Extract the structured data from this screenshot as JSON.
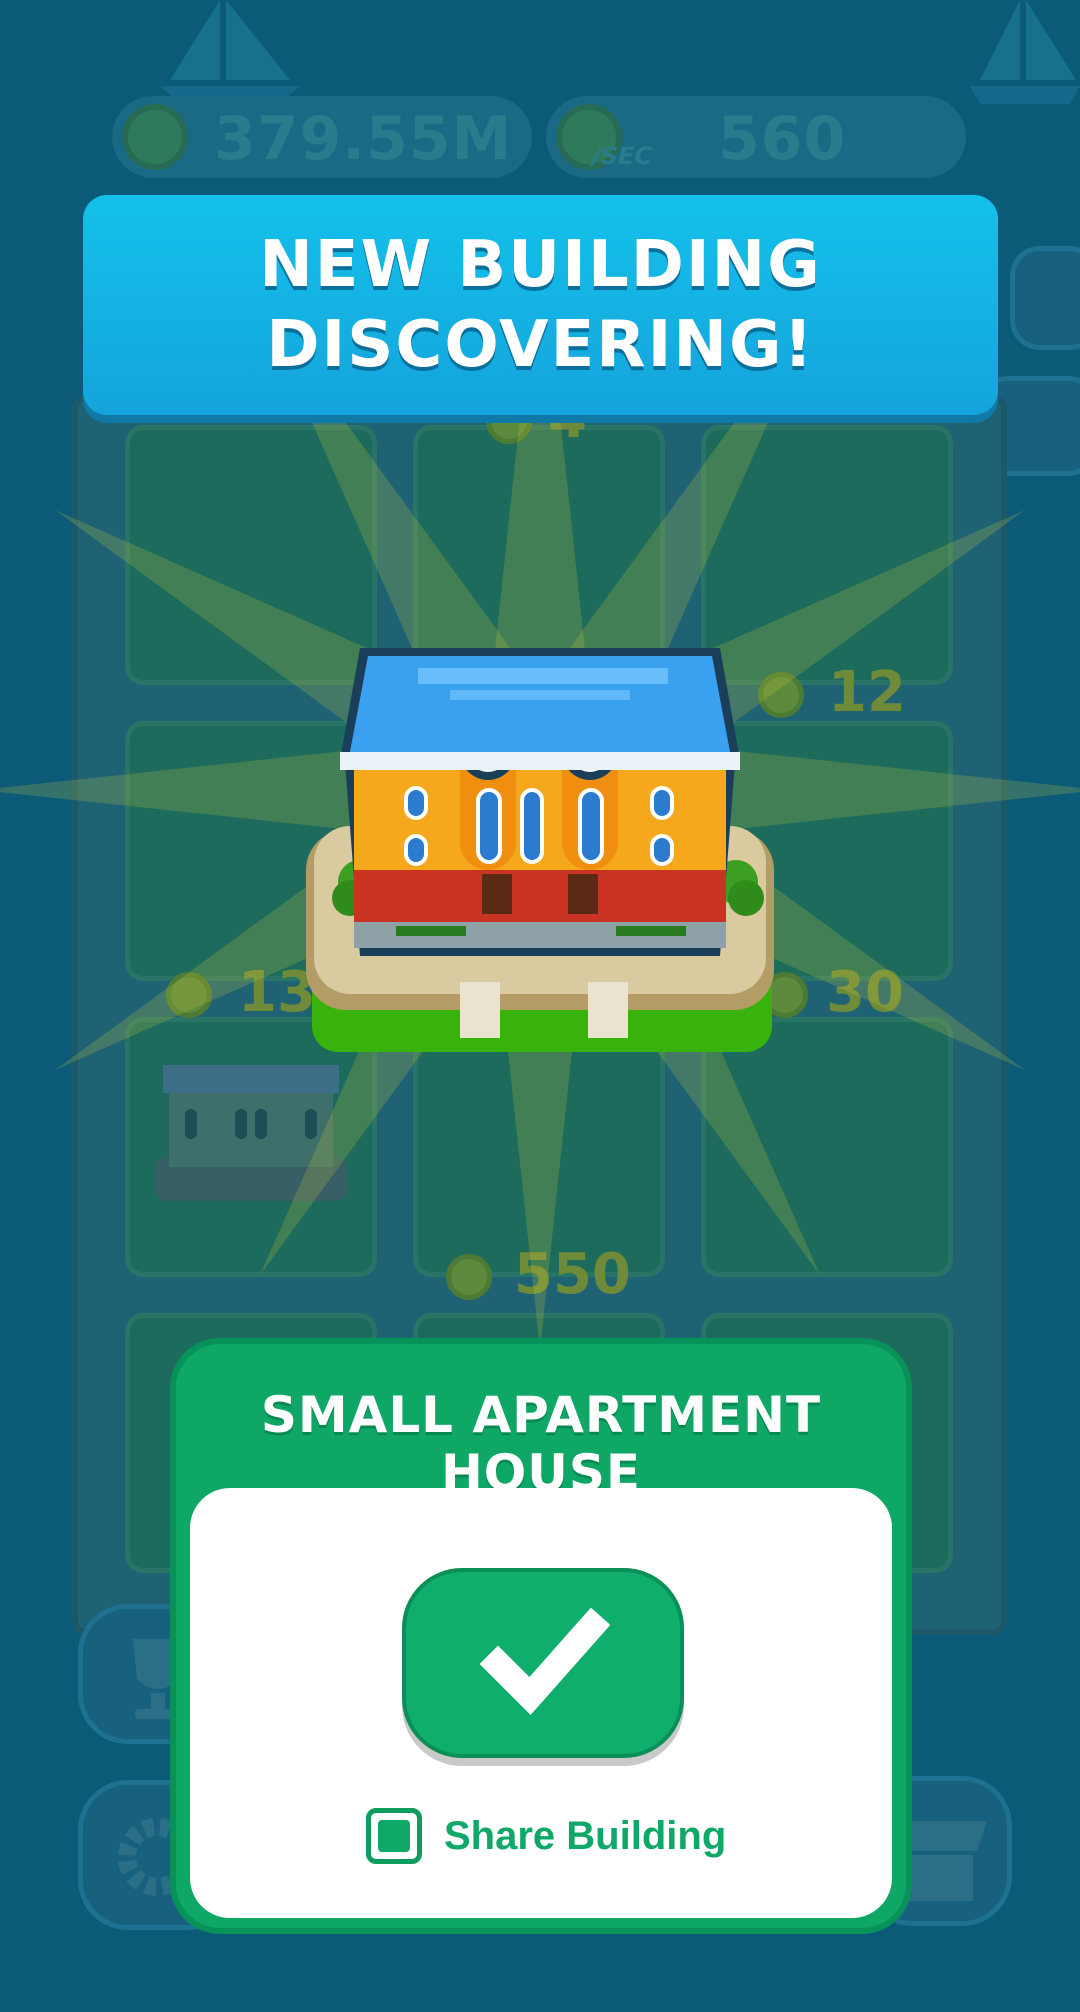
{
  "hud": {
    "coins": "379.55M",
    "per_sec_value": "560",
    "per_sec_unit": "/SEC"
  },
  "board_tags": [
    "4",
    "12",
    "130",
    "30",
    "550"
  ],
  "banner": {
    "line1": "NEW BUILDING",
    "line2": "DISCOVERING!"
  },
  "dialog": {
    "title": "SMALL APARTMENT HOUSE",
    "share_label": "Share Building",
    "share_checked": true
  },
  "icons": {
    "confirm": "checkmark-icon",
    "coin": "coin-icon",
    "settings": "gear-icon",
    "achievements": "trophy-icon",
    "shop": "shop-icon",
    "buildings": "building-icon"
  },
  "colors": {
    "banner": "#14b4e4",
    "dialog_green": "#0fa766",
    "background": "#0b5a78"
  }
}
